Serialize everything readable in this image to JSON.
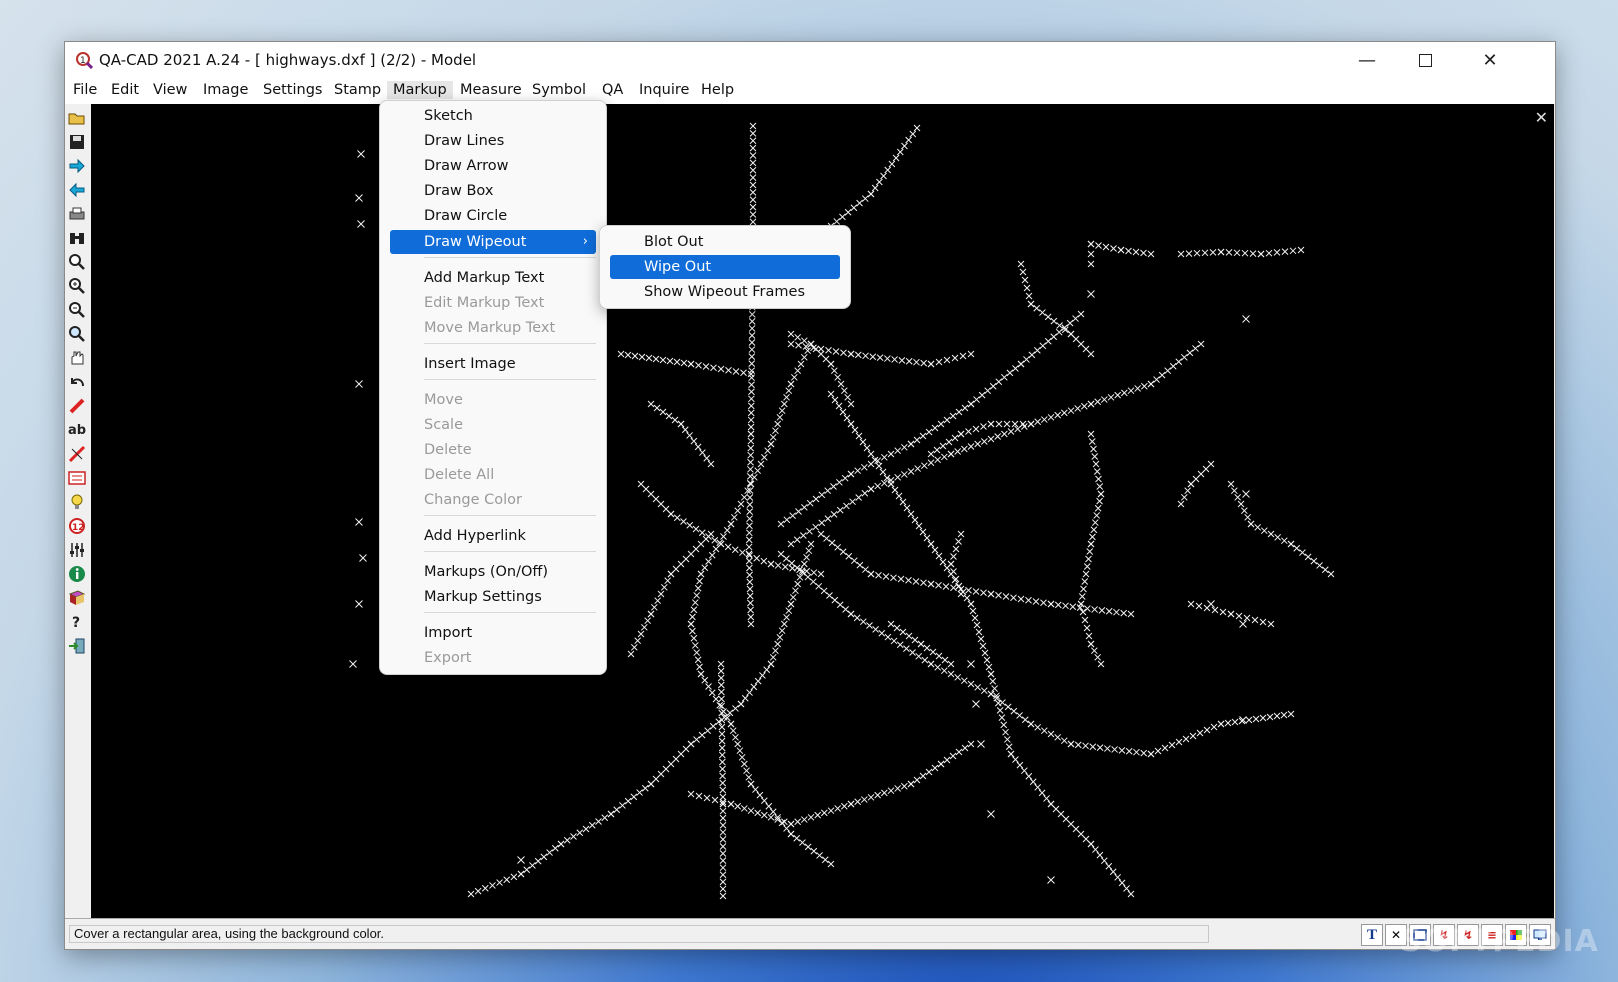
{
  "window": {
    "title": "QA-CAD 2021 A.24  -  [ highways.dxf ] (2/2)  -  Model",
    "minimize_icon": "minimize-icon",
    "maximize_icon": "maximize-icon",
    "close_icon": "close-icon"
  },
  "menubar": {
    "items": [
      "File",
      "Edit",
      "View",
      "Image",
      "Settings",
      "Stamp",
      "Markup",
      "Measure",
      "Symbol",
      "QA",
      "Inquire",
      "Help"
    ],
    "active": "Markup"
  },
  "markup_menu": {
    "items": [
      {
        "label": "Sketch",
        "enabled": true
      },
      {
        "label": "Draw Lines",
        "enabled": true
      },
      {
        "label": "Draw Arrow",
        "enabled": true
      },
      {
        "label": "Draw Box",
        "enabled": true
      },
      {
        "label": "Draw Circle",
        "enabled": true
      },
      {
        "label": "Draw Wipeout",
        "enabled": true,
        "submenu": true,
        "highlighted": true
      },
      {
        "label": "Add Markup Text",
        "enabled": true
      },
      {
        "label": "Edit Markup Text",
        "enabled": false
      },
      {
        "label": "Move Markup Text",
        "enabled": false
      },
      {
        "label": "Insert Image",
        "enabled": true
      },
      {
        "label": "Move",
        "enabled": false
      },
      {
        "label": "Scale",
        "enabled": false
      },
      {
        "label": "Delete",
        "enabled": false
      },
      {
        "label": "Delete All",
        "enabled": false
      },
      {
        "label": "Change Color",
        "enabled": false
      },
      {
        "label": "Add Hyperlink",
        "enabled": true
      },
      {
        "label": "Markups (On/Off)",
        "enabled": true
      },
      {
        "label": "Markup Settings",
        "enabled": true
      },
      {
        "label": "Import",
        "enabled": true
      },
      {
        "label": "Export",
        "enabled": false
      }
    ]
  },
  "wipeout_submenu": {
    "items": [
      {
        "label": "Blot Out",
        "highlighted": false
      },
      {
        "label": "Wipe Out",
        "highlighted": true
      },
      {
        "label": "Show Wipeout Frames",
        "highlighted": false
      }
    ]
  },
  "toolbar": {
    "icons": [
      "open-icon",
      "save-icon",
      "forward-icon",
      "back-icon",
      "print-icon",
      "binoculars-icon",
      "zoom-icon",
      "zoom-in-icon",
      "zoom-out-icon",
      "zoom-window-icon",
      "pan-hand-icon",
      "undo-icon",
      "pencil-icon",
      "text-ab-icon",
      "measure-icon",
      "stamp-icon",
      "light-bulb-icon",
      "symbol-icon",
      "settings-sliders-icon",
      "info-icon",
      "book-icon",
      "help-icon",
      "exit-icon"
    ],
    "text_icon_label": "ab"
  },
  "statusbar": {
    "text": "Cover a rectangular area, using the background color.",
    "icons": [
      "text-T-icon",
      "x-icon",
      "frame-icon",
      "lightning-icon",
      "lightning2-icon",
      "layers-icon",
      "color-icon",
      "monitor-icon"
    ],
    "text_icon_label": "T"
  },
  "watermark": "SOFTPEDIA",
  "colors": {
    "canvas": "#000000",
    "drawing": "#ffffff",
    "highlight": "#0f6cd8"
  }
}
